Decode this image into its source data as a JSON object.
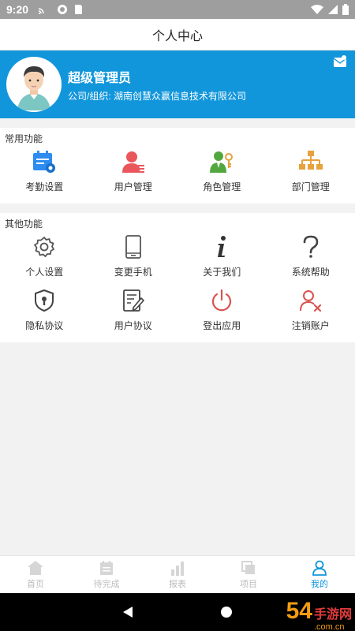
{
  "status_bar": {
    "time": "9:20"
  },
  "header": {
    "title": "个人中心"
  },
  "profile": {
    "name": "超级管理员",
    "org": "公司/组织: 湖南创慧众赢信息技术有限公司"
  },
  "common": {
    "title": "常用功能",
    "items": [
      {
        "label": "考勤设置",
        "icon": "attendance-settings-icon",
        "color": "#2d8cf0"
      },
      {
        "label": "用户管理",
        "icon": "user-management-icon",
        "color": "#e9575c"
      },
      {
        "label": "角色管理",
        "icon": "role-management-icon",
        "color": "#52a83e"
      },
      {
        "label": "部门管理",
        "icon": "department-management-icon",
        "color": "#e6a23c"
      }
    ]
  },
  "other": {
    "title": "其他功能",
    "items": [
      {
        "label": "个人设置",
        "icon": "gear-icon"
      },
      {
        "label": "变更手机",
        "icon": "phone-icon"
      },
      {
        "label": "关于我们",
        "icon": "info-icon"
      },
      {
        "label": "系统帮助",
        "icon": "question-icon"
      },
      {
        "label": "隐私协议",
        "icon": "shield-icon"
      },
      {
        "label": "用户协议",
        "icon": "document-edit-icon"
      },
      {
        "label": "登出应用",
        "icon": "power-icon",
        "color": "#d9534f"
      },
      {
        "label": "注销账户",
        "icon": "user-remove-icon",
        "color": "#d9534f"
      }
    ]
  },
  "tabs": [
    {
      "label": "首页",
      "icon": "home-icon",
      "active": false
    },
    {
      "label": "待完成",
      "icon": "calendar-icon",
      "active": false
    },
    {
      "label": "报表",
      "icon": "bar-chart-icon",
      "active": false
    },
    {
      "label": "项目",
      "icon": "project-icon",
      "active": false
    },
    {
      "label": "我的",
      "icon": "profile-icon",
      "active": true
    }
  ],
  "colors": {
    "accent": "#1296db",
    "tab_inactive": "#bbbbbb"
  },
  "watermark": {
    "number": "54",
    "brand_cn": "手游网",
    "domain": ".com.cn"
  }
}
